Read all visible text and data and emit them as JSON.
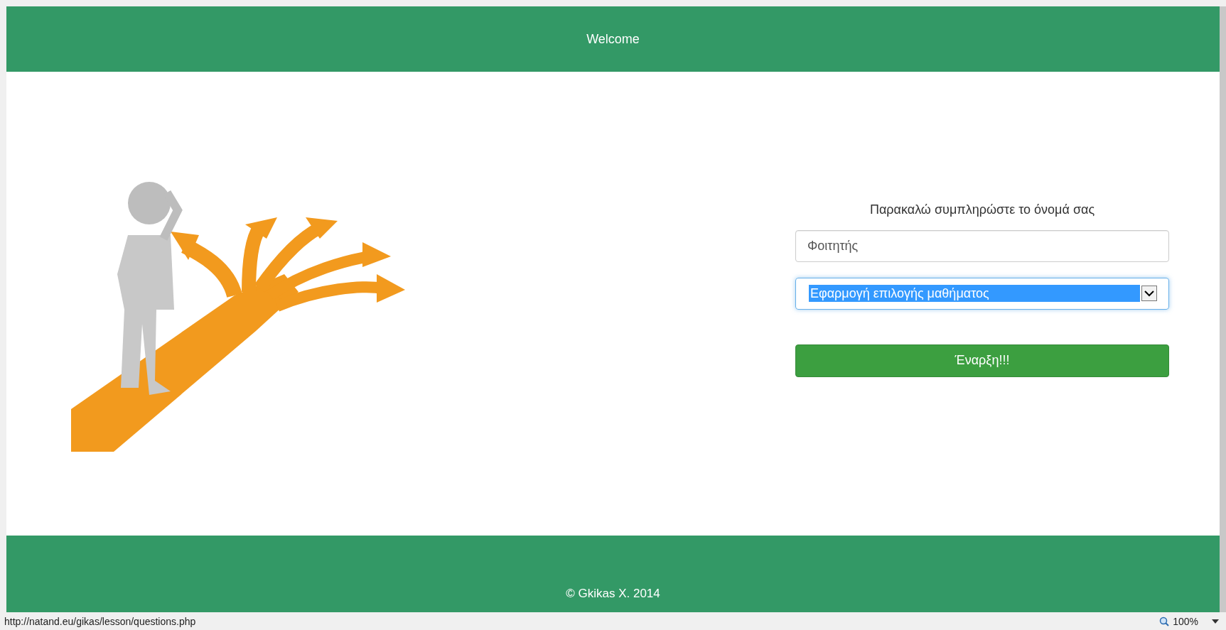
{
  "header": {
    "title": "Welcome"
  },
  "form": {
    "prompt": "Παρακαλώ συμπληρώστε το όνομά σας",
    "name_field": {
      "value": "Φοιτητής"
    },
    "course_select": {
      "value": "Εφαρμογή επιλογής μαθήματος"
    },
    "start_button": "Έναρξη!!!"
  },
  "footer": {
    "text": "© Gkikas X. 2014"
  },
  "status_bar": {
    "url": "http://natand.eu/gikas/lesson/questions.php",
    "zoom": "100%"
  }
}
